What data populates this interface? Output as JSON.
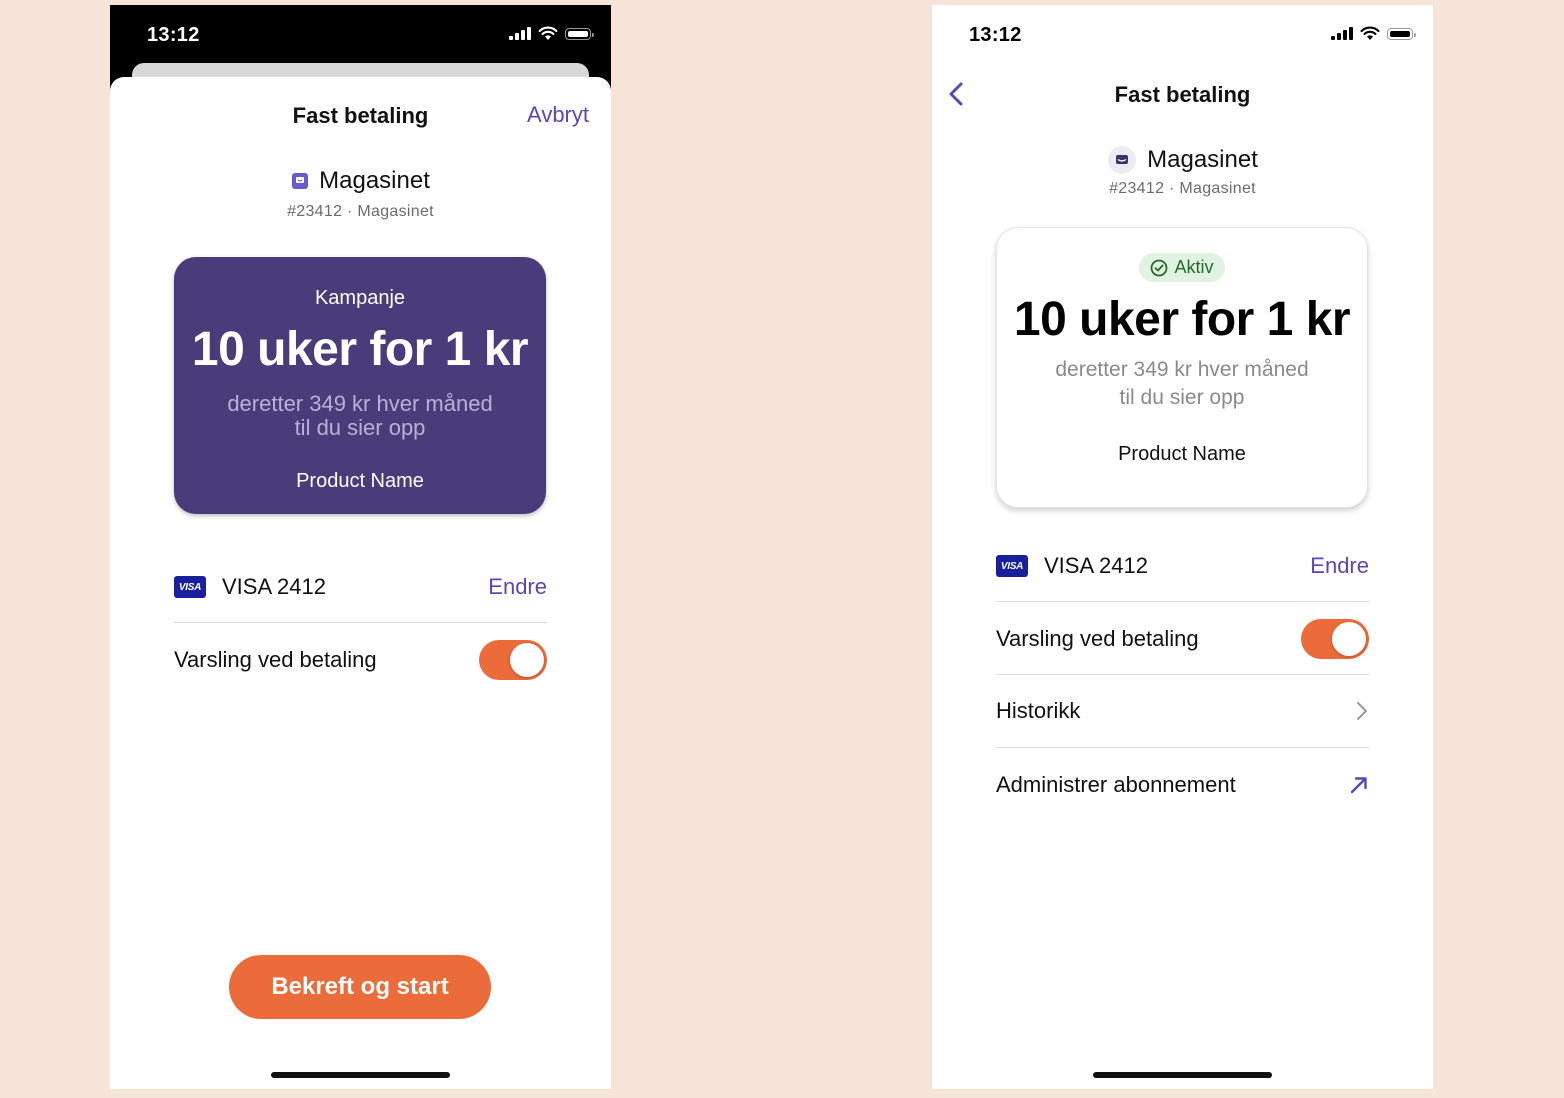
{
  "colors": {
    "accent": "#5b46b5",
    "orange": "#ec6b3a",
    "purple_card": "#4a3b7b",
    "background": "#f6e4d8"
  },
  "left_screen": {
    "status": {
      "time": "13:12"
    },
    "title": "Fast betaling",
    "cancel_label": "Avbryt",
    "merchant": {
      "name": "Magasinet",
      "ref": "#23412 · Magasinet",
      "icon": "magasinet-logo-icon"
    },
    "offer": {
      "tag": "Kampanje",
      "headline": "10 uker for 1 kr",
      "line1": "deretter 349 kr hver måned",
      "line2": "til du sier opp",
      "product": "Product Name"
    },
    "card": {
      "brand": "VISA",
      "label": "VISA 2412",
      "action": "Endre"
    },
    "notify": {
      "label": "Varsling ved betaling",
      "on": true
    },
    "cta_label": "Bekreft og start"
  },
  "right_screen": {
    "status": {
      "time": "13:12"
    },
    "title": "Fast betaling",
    "merchant": {
      "name": "Magasinet",
      "ref": "#23412 · Magasinet",
      "icon": "magasinet-logo-icon"
    },
    "offer": {
      "status": "Aktiv",
      "headline": "10 uker for 1 kr",
      "line1": "deretter 349 kr hver måned",
      "line2": "til du sier opp",
      "product": "Product Name"
    },
    "card": {
      "brand": "VISA",
      "label": "VISA 2412",
      "action": "Endre"
    },
    "notify": {
      "label": "Varsling ved betaling",
      "on": true
    },
    "history_label": "Historikk",
    "manage_label": "Administrer abonnement"
  }
}
